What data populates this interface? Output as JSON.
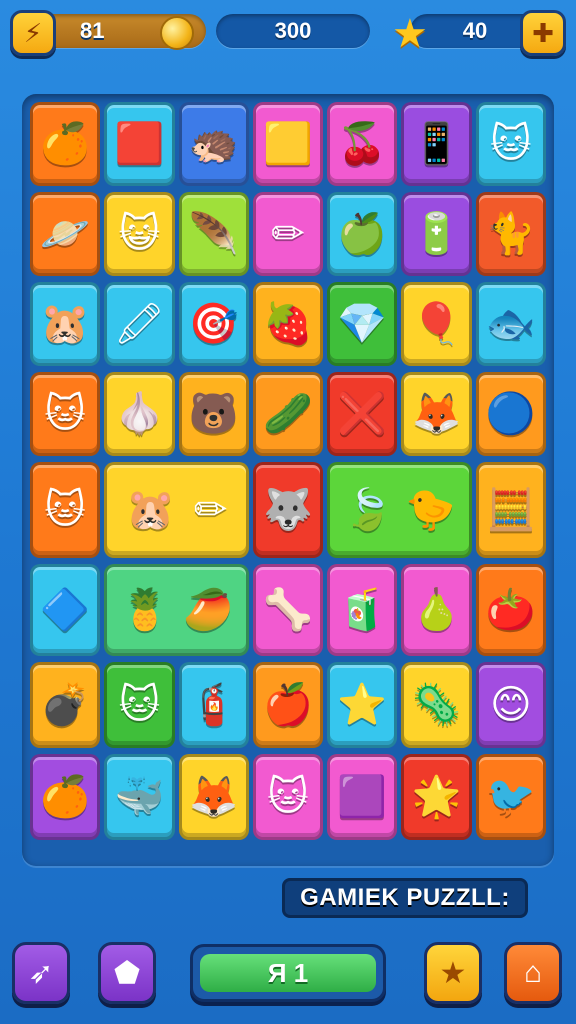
{
  "hud": {
    "coins_badge_icon": "lightning-star-icon",
    "coins": "81",
    "score": "300",
    "stars": "40",
    "add_button_icon": "plus-icon"
  },
  "title": "GAMIEK PUZZLL:",
  "bottom_bar": {
    "level_label": "Я 1",
    "buttons": [
      {
        "name": "rocket-button",
        "icon": "rocket-icon"
      },
      {
        "name": "tag-button",
        "icon": "tag-icon"
      },
      {
        "name": "star-button",
        "icon": "star-icon"
      },
      {
        "name": "home-button",
        "icon": "home-icon"
      }
    ]
  },
  "board": {
    "rows": [
      {
        "height": 84,
        "tiles": [
          {
            "span": 1,
            "color": "#ff7a1a",
            "icons": [
              "🍊"
            ]
          },
          {
            "span": 1,
            "color": "#36c6ee",
            "icons": [
              "🟥"
            ]
          },
          {
            "span": 1,
            "color": "#3d7be8",
            "icons": [
              "🦔"
            ]
          },
          {
            "span": 1,
            "color": "#f25ad0",
            "icons": [
              "🟨"
            ]
          },
          {
            "span": 1,
            "color": "#f25ad0",
            "icons": [
              "🍒"
            ]
          },
          {
            "span": 1,
            "color": "#9a4de0",
            "icons": [
              "📱"
            ]
          },
          {
            "span": 1,
            "color": "#36c6ee",
            "icons": [
              "🐱"
            ]
          }
        ]
      },
      {
        "height": 84,
        "tiles": [
          {
            "span": 1,
            "color": "#ff7a1a",
            "icons": [
              "🪐"
            ]
          },
          {
            "span": 1,
            "color": "#ffd42a",
            "icons": [
              "😺"
            ]
          },
          {
            "span": 1,
            "color": "#9fe03a",
            "icons": [
              "🪶"
            ]
          },
          {
            "span": 1,
            "color": "#f25ad0",
            "icons": [
              "✏"
            ]
          },
          {
            "span": 1,
            "color": "#36c6ee",
            "icons": [
              "🍏"
            ]
          },
          {
            "span": 1,
            "color": "#9a4de0",
            "icons": [
              "🔋"
            ]
          },
          {
            "span": 1,
            "color": "#f25a2a",
            "icons": [
              "🐈"
            ]
          }
        ]
      },
      {
        "height": 84,
        "tiles": [
          {
            "span": 1,
            "color": "#36c6ee",
            "icons": [
              "🐹"
            ]
          },
          {
            "span": 1,
            "color": "#36c6ee",
            "icons": [
              "🖍"
            ]
          },
          {
            "span": 1,
            "color": "#36c6ee",
            "icons": [
              "🎯"
            ]
          },
          {
            "span": 1,
            "color": "#ffb21e",
            "icons": [
              "🍓"
            ]
          },
          {
            "span": 1,
            "color": "#3fbf3a",
            "icons": [
              "💎"
            ]
          },
          {
            "span": 1,
            "color": "#ffd42a",
            "icons": [
              "🎈"
            ]
          },
          {
            "span": 1,
            "color": "#36c6ee",
            "icons": [
              "🐟"
            ]
          }
        ]
      },
      {
        "height": 84,
        "tiles": [
          {
            "span": 1,
            "color": "#ff7a1a",
            "icons": [
              "🐱"
            ]
          },
          {
            "span": 1,
            "color": "#ffd42a",
            "icons": [
              "🧄"
            ]
          },
          {
            "span": 1,
            "color": "#ffb21e",
            "icons": [
              "🐻"
            ]
          },
          {
            "span": 1,
            "color": "#ff9a1e",
            "icons": [
              "🥒"
            ]
          },
          {
            "span": 1,
            "color": "#f03a2a",
            "icons": [
              "❌"
            ]
          },
          {
            "span": 1,
            "color": "#ffd42a",
            "icons": [
              "🦊"
            ]
          },
          {
            "span": 1,
            "color": "#ff9a1e",
            "icons": [
              "🔵"
            ]
          }
        ]
      },
      {
        "height": 96,
        "tiles": [
          {
            "span": 1,
            "color": "#ff7a1a",
            "icons": [
              "🐱"
            ]
          },
          {
            "span": 2,
            "color": "#ffd42a",
            "icons": [
              "🐹",
              "✏"
            ]
          },
          {
            "span": 1,
            "color": "#f03a2a",
            "icons": [
              "🐺"
            ]
          },
          {
            "span": 2,
            "color": "#5cd63a",
            "icons": [
              "🍃",
              "🐤"
            ]
          },
          {
            "span": 1,
            "color": "#ffb21e",
            "icons": [
              "🧮"
            ]
          }
        ]
      },
      {
        "height": 92,
        "tiles": [
          {
            "span": 1,
            "color": "#36c6ee",
            "icons": [
              "🔷"
            ]
          },
          {
            "span": 2,
            "color": "#4fd483",
            "icons": [
              "🍍",
              "🥭"
            ]
          },
          {
            "span": 1,
            "color": "#f25ad0",
            "icons": [
              "🦴"
            ]
          },
          {
            "span": 1,
            "color": "#f25ad0",
            "icons": [
              "🧃"
            ]
          },
          {
            "span": 1,
            "color": "#f25ad0",
            "icons": [
              "🍐"
            ]
          },
          {
            "span": 1,
            "color": "#ff7a1a",
            "icons": [
              "🍅"
            ]
          }
        ]
      },
      {
        "height": 86,
        "tiles": [
          {
            "span": 1,
            "color": "#ffb21e",
            "icons": [
              "💣"
            ]
          },
          {
            "span": 1,
            "color": "#3fbf3a",
            "icons": [
              "🐱"
            ]
          },
          {
            "span": 1,
            "color": "#36c6ee",
            "icons": [
              "🧯"
            ]
          },
          {
            "span": 1,
            "color": "#ff9a1e",
            "icons": [
              "🍎"
            ]
          },
          {
            "span": 1,
            "color": "#36c6ee",
            "icons": [
              "⭐"
            ]
          },
          {
            "span": 1,
            "color": "#ffd42a",
            "icons": [
              "🦠"
            ]
          },
          {
            "span": 1,
            "color": "#a24de0",
            "icons": [
              "😊"
            ]
          }
        ]
      },
      {
        "height": 86,
        "tiles": [
          {
            "span": 1,
            "color": "#a24de0",
            "icons": [
              "🍊"
            ]
          },
          {
            "span": 1,
            "color": "#36c6ee",
            "icons": [
              "🐳"
            ]
          },
          {
            "span": 1,
            "color": "#ffd42a",
            "icons": [
              "🦊"
            ]
          },
          {
            "span": 1,
            "color": "#f25ad0",
            "icons": [
              "🐱"
            ]
          },
          {
            "span": 1,
            "color": "#f25ad0",
            "icons": [
              "🟪"
            ]
          },
          {
            "span": 1,
            "color": "#f03a2a",
            "icons": [
              "🌟"
            ]
          },
          {
            "span": 1,
            "color": "#ff7a1a",
            "icons": [
              "🐦"
            ]
          }
        ]
      }
    ]
  }
}
